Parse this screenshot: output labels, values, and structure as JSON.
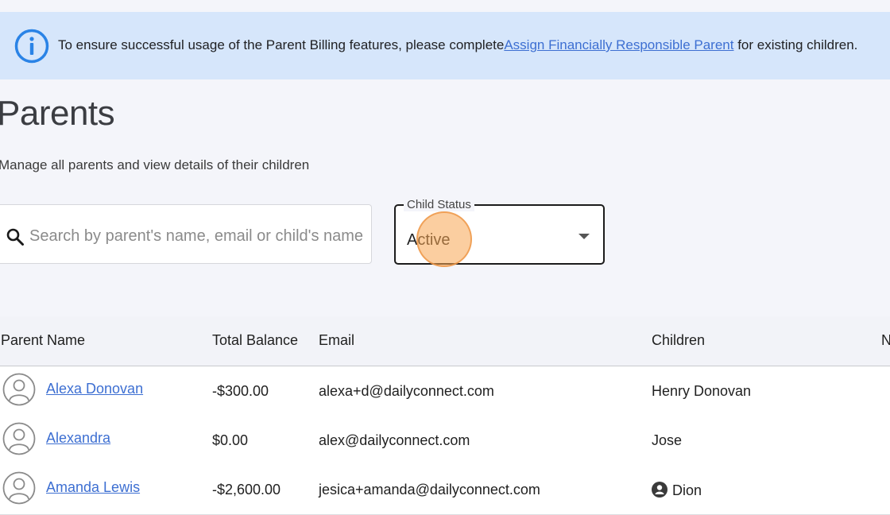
{
  "banner": {
    "text_before": "To ensure successful usage of the Parent Billing features, please complete",
    "link_text": "Assign Financially Responsible Parent",
    "text_after": " for existing children."
  },
  "page": {
    "title": "Parents",
    "subtitle": "Manage all parents and view details of their children"
  },
  "filters": {
    "search_placeholder": "Search by parent's name, email or child's name",
    "child_status_label": "Child Status",
    "child_status_value": "Active"
  },
  "table": {
    "columns": [
      "Parent Name",
      "Total Balance",
      "Email",
      "Children",
      "N"
    ],
    "rows": [
      {
        "name": "Alexa Donovan",
        "balance": "-$300.00",
        "email": "alexa+d@dailyconnect.com",
        "children": "Henry Donovan",
        "child_icon": false
      },
      {
        "name": "Alexandra",
        "balance": "$0.00",
        "email": "alex@dailyconnect.com",
        "children": "Jose",
        "child_icon": false
      },
      {
        "name": "Amanda Lewis",
        "balance": "-$2,600.00",
        "email": "jesica+amanda@dailyconnect.com",
        "children": "Dion",
        "child_icon": true
      }
    ]
  },
  "icons": {
    "info": "info-icon",
    "search": "search-icon",
    "dropdown": "chevron-down-icon",
    "avatar": "user-avatar-icon",
    "child": "child-avatar-icon"
  },
  "colors": {
    "banner_bg": "#d6e6fb",
    "link": "#3d6fd2",
    "accent": "#2a83e6",
    "click_marker": "#f7a652"
  }
}
